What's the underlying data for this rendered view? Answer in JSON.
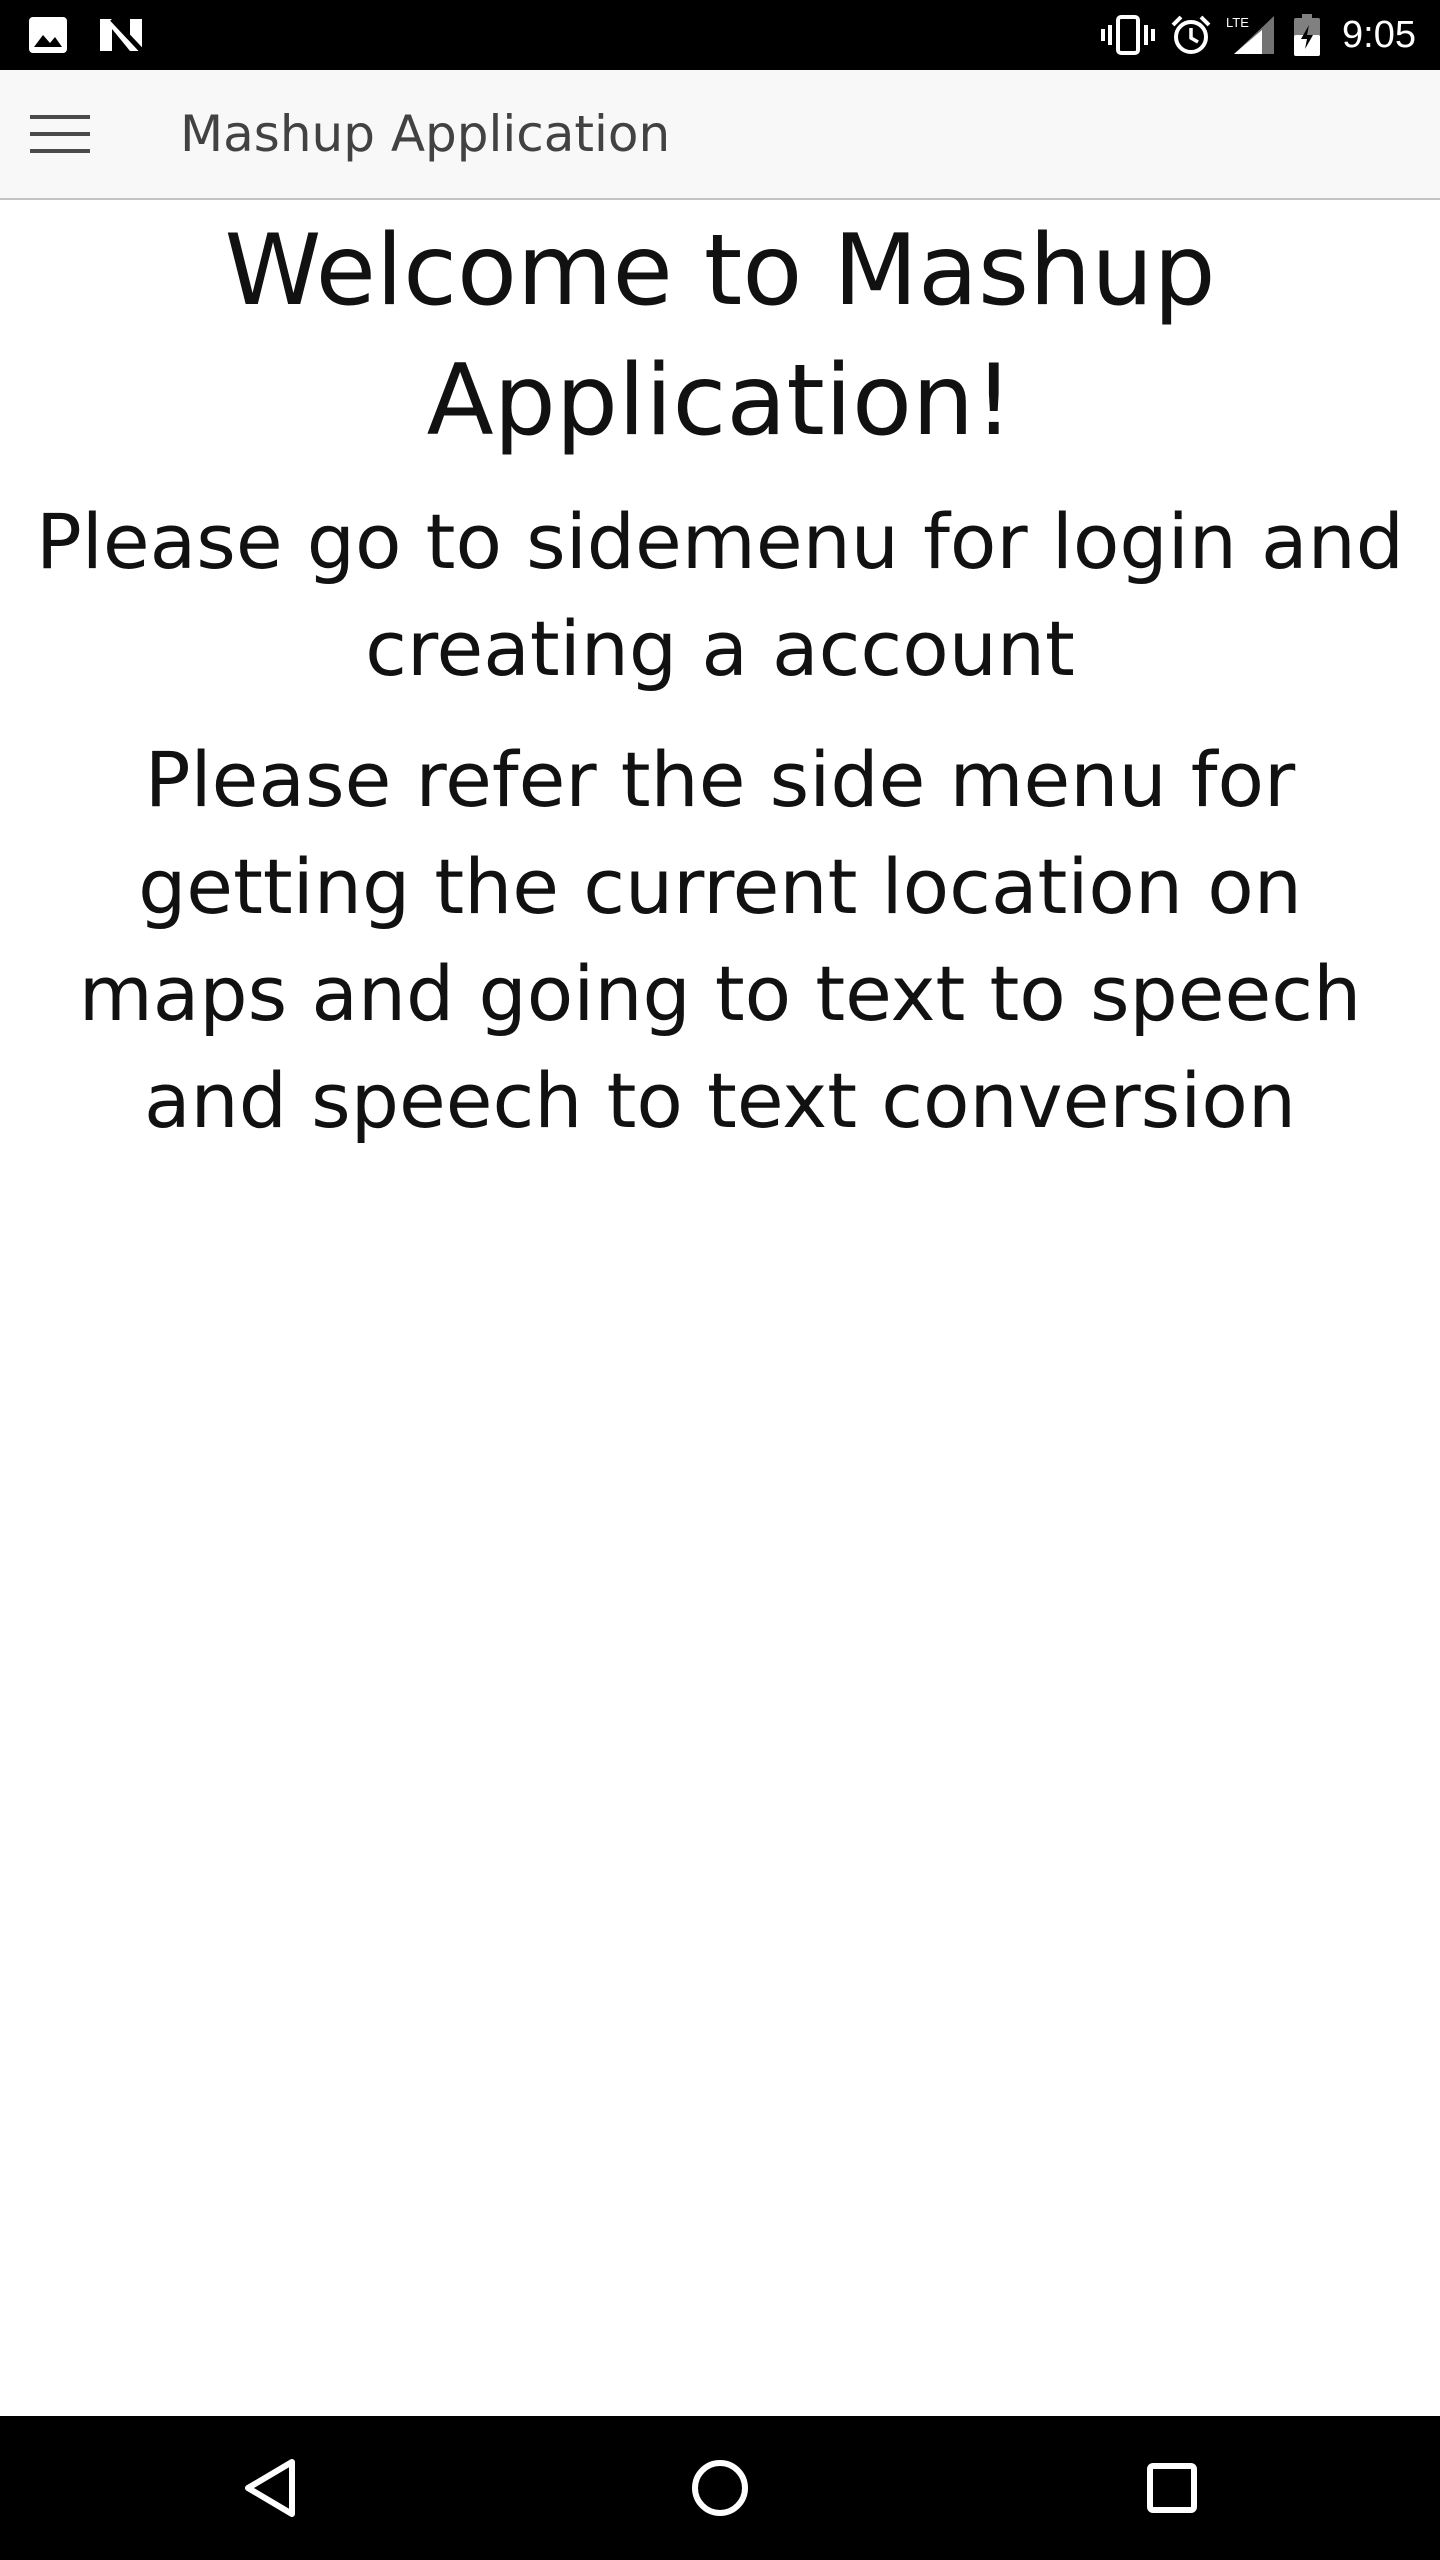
{
  "status_bar": {
    "time": "9:05",
    "left_icons": [
      "image-notification-icon",
      "n-notification-icon"
    ],
    "right_icons": [
      "vibrate-icon",
      "alarm-icon",
      "lte-signal-icon",
      "battery-icon"
    ]
  },
  "app_bar": {
    "title": "Mashup Application",
    "menu_icon": "hamburger-menu-icon"
  },
  "content": {
    "welcome_title": "Welcome to Mashup Application!",
    "instruction_1": "Please go to sidemenu for login and creating a account",
    "instruction_2": "Please refer the side menu for getting the current location on maps and going to text to speech and speech to text conversion"
  },
  "nav_bar": {
    "buttons": [
      "back-icon",
      "home-icon",
      "recent-apps-icon"
    ]
  },
  "colors": {
    "status_bar_bg": "#000000",
    "app_bar_bg": "#f8f8f8",
    "app_title": "#424242",
    "body_text": "#111111",
    "nav_bar_bg": "#000000"
  }
}
